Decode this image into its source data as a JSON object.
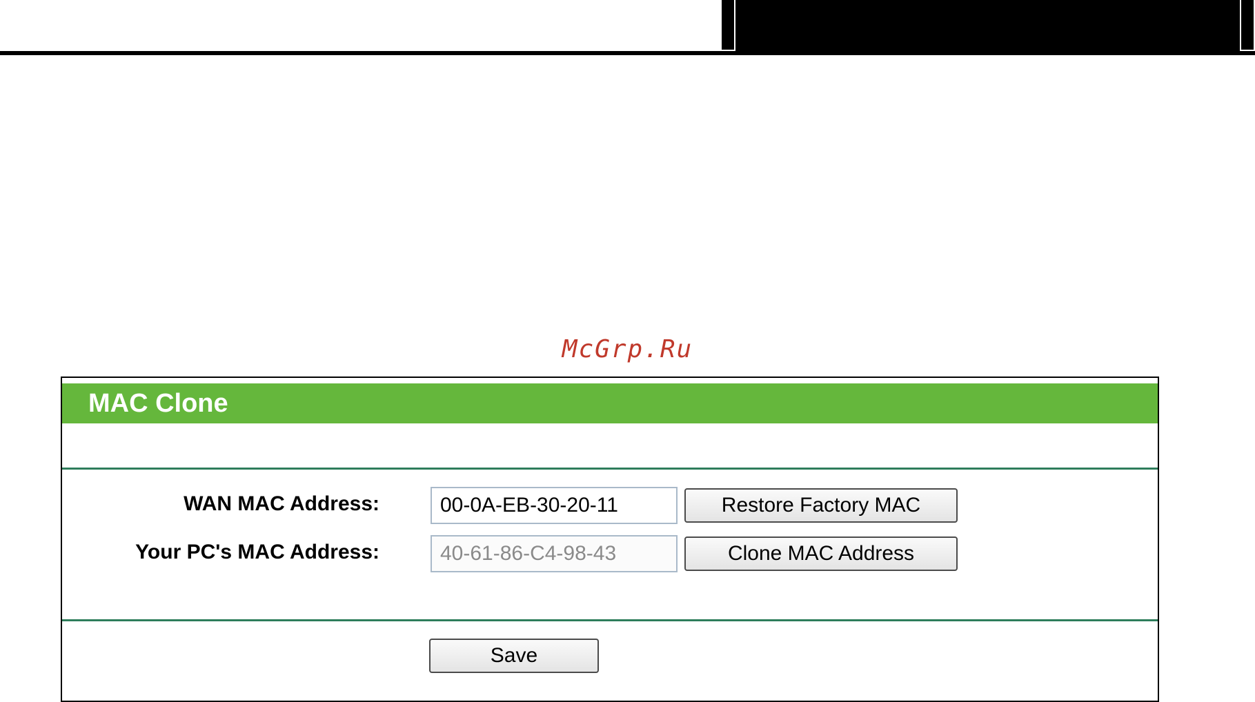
{
  "watermark": "McGrp.Ru",
  "panel": {
    "title": "MAC Clone",
    "header_color": "#65b73c",
    "divider_color": "#2e7d5b"
  },
  "form": {
    "wan_label": "WAN MAC Address:",
    "wan_value": "00-0A-EB-30-20-11",
    "pc_label": "Your PC's MAC Address:",
    "pc_value": "40-61-86-C4-98-43",
    "restore_button": "Restore Factory MAC",
    "clone_button": "Clone MAC Address",
    "save_button": "Save"
  }
}
